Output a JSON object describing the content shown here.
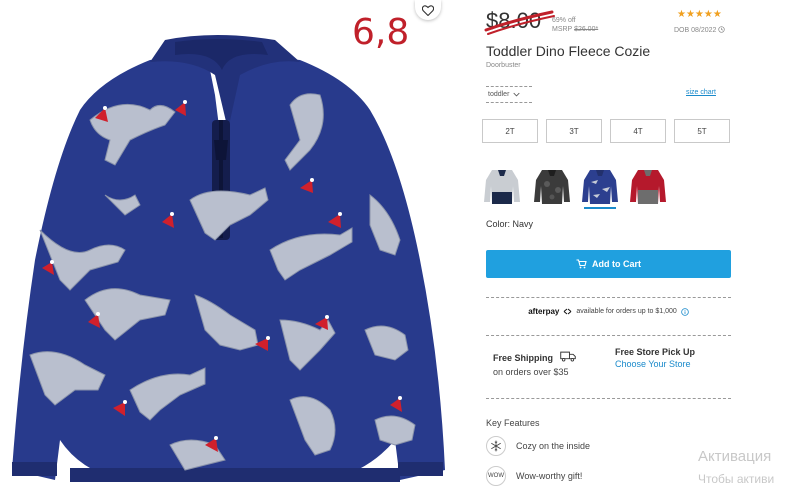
{
  "annotation": "6,8",
  "price": {
    "sale": "$8.00",
    "percent_off": "69% off",
    "msrp_label": "MSRP",
    "msrp_value": "$26.00*"
  },
  "rating": {
    "stars": 5,
    "stars_text": "★★★★★",
    "dob": "DOB 08/2022"
  },
  "product": {
    "title": "Toddler Dino Fleece Cozie",
    "subtitle": "Doorbuster"
  },
  "size_select": {
    "value": "toddler",
    "chevron": "chevron-down-icon"
  },
  "size_chart_label": "size chart",
  "sizes": [
    "2T",
    "3T",
    "4T",
    "5T"
  ],
  "swatches": [
    {
      "name": "heather-gray-navy",
      "body": "#c9cdd2",
      "bottom": "#1c2a4a",
      "selected": false
    },
    {
      "name": "black-camo",
      "body": "#3b3b3b",
      "bottom": "#1e1e1e",
      "selected": false
    },
    {
      "name": "navy-dino",
      "body": "#2c3f8f",
      "bottom": "#22306c",
      "selected": true
    },
    {
      "name": "red-gray",
      "body": "#b5192c",
      "bottom": "#6d6d6d",
      "selected": false
    }
  ],
  "color_label": "Color: Navy",
  "add_to_cart_label": "Add to Cart",
  "afterpay": {
    "logo": "afterpay",
    "text": "available for orders up to $1,000"
  },
  "shipping": {
    "title": "Free Shipping",
    "subtitle": "on orders over $35"
  },
  "pickup": {
    "title": "Free Store Pick Up",
    "link": "Choose Your Store"
  },
  "key_features": {
    "heading": "Key Features",
    "items": [
      {
        "icon": "snowflake-icon",
        "text": "Cozy on the inside"
      },
      {
        "icon": "wow-badge-icon",
        "icon_text": "WOW",
        "text": "Wow-worthy gift!"
      }
    ]
  },
  "watermark": {
    "line1": "Активация",
    "line2": "Чтобы активи"
  },
  "colors": {
    "accent": "#20a0df",
    "link": "#1a8acb",
    "star": "#f0a020",
    "strike": "#c0202a",
    "fleece": "#283a8c"
  }
}
